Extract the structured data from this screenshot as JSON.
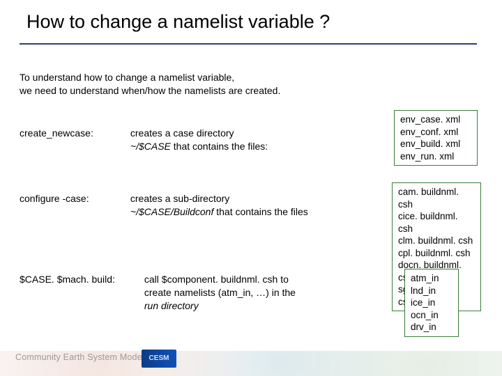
{
  "title": "How to change a namelist variable ?",
  "intro_line1": "To understand how to change a namelist variable,",
  "intro_line2": "we need to understand when/how the namelists are created.",
  "rows": [
    {
      "cmd": "create_newcase:",
      "desc_pre": "creates a case directory ",
      "desc_em": "~/$CASE",
      "desc_post": " that contains the files:"
    },
    {
      "cmd": "configure -case:",
      "desc_pre": "creates a sub-directory ",
      "desc_em": "~/$CASE/Buildconf",
      "desc_post": " that contains the files"
    },
    {
      "cmd": "$CASE. $mach. build:",
      "desc_pre": "call $component. buildnml. csh to create namelists (atm_in, …) in the ",
      "desc_em": "run directory",
      "desc_post": ""
    }
  ],
  "boxes": [
    {
      "lines": [
        "env_case. xml",
        "env_conf. xml",
        "env_build. xml",
        "env_run. xml"
      ]
    },
    {
      "lines": [
        "cam. buildnml. csh",
        "cice. buildnml. csh",
        "clm. buildnml. csh",
        "cpl. buildnml. csh",
        "docn. buildnml. csh",
        "sglc. buildnml. csh"
      ]
    },
    {
      "lines": [
        "atm_in",
        "lnd_in",
        "ice_in",
        "ocn_in",
        "drv_in"
      ]
    }
  ],
  "footer": {
    "text": "Community Earth System Model Tutorial",
    "logo": "CESM"
  }
}
